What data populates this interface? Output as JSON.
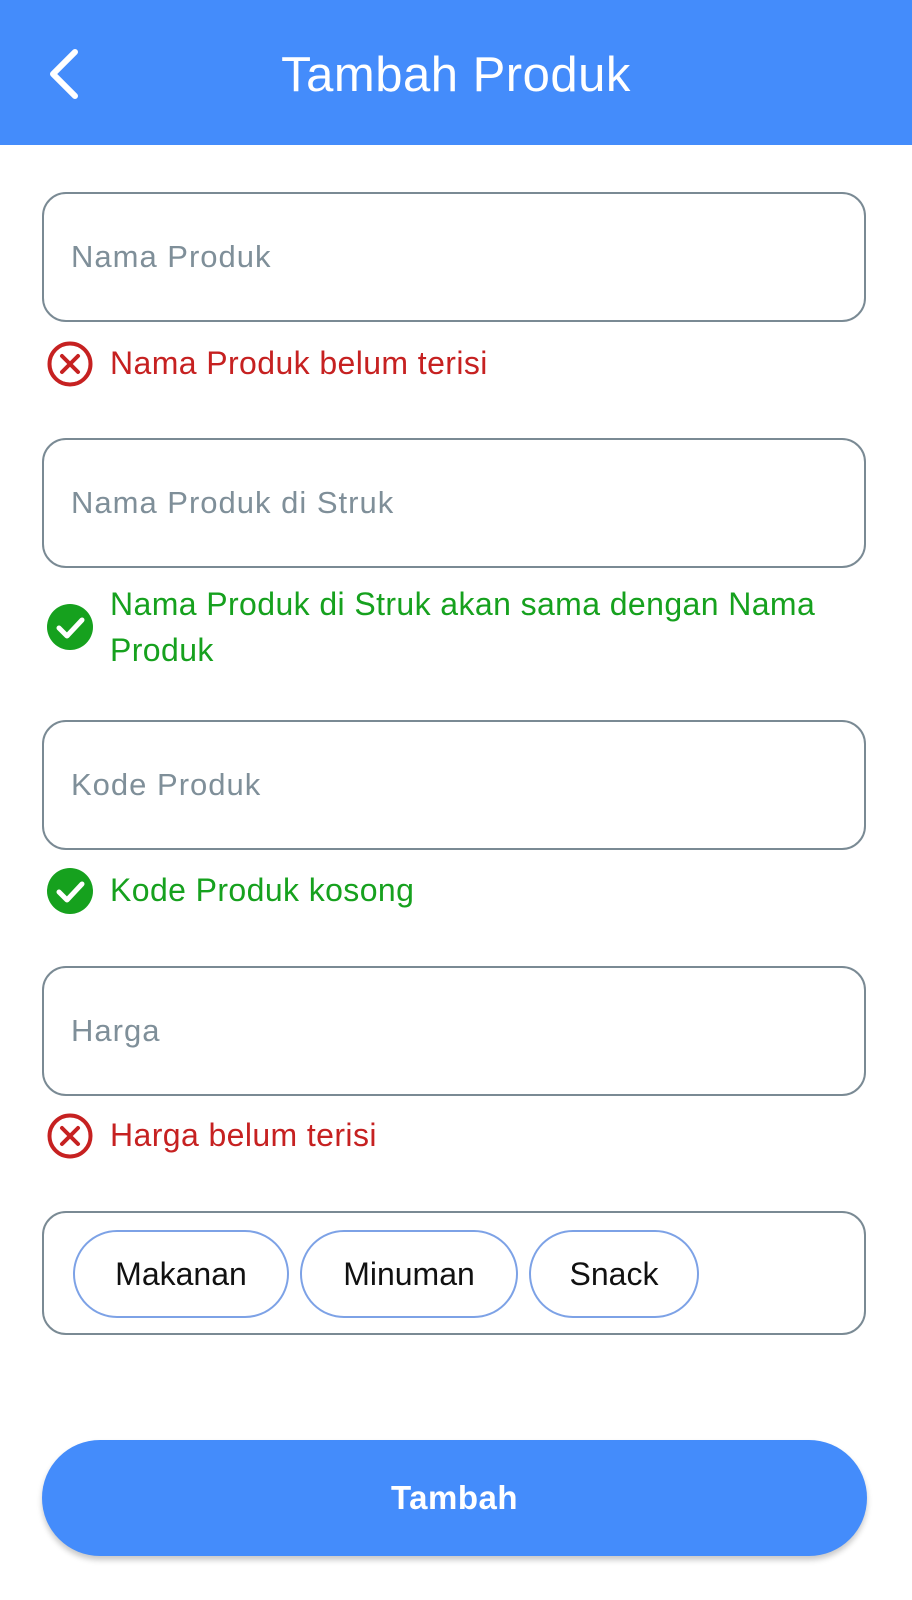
{
  "header": {
    "title": "Tambah Produk",
    "back_icon": "chevron-left-icon",
    "background": "#448cfb"
  },
  "form": {
    "product_name": {
      "value": "",
      "placeholder": "Nama Produk",
      "message": "Nama Produk belum terisi",
      "status": "error"
    },
    "receipt_name": {
      "value": "",
      "placeholder": "Nama Produk di Struk",
      "message": "Nama Produk di Struk akan sama dengan Nama Produk",
      "status": "ok"
    },
    "product_code": {
      "value": "",
      "placeholder": "Kode Produk",
      "message": "Kode Produk kosong",
      "status": "ok"
    },
    "price": {
      "value": "",
      "placeholder": "Harga",
      "message": "Harga belum terisi",
      "status": "error"
    },
    "categories": [
      {
        "label": "Makanan"
      },
      {
        "label": "Minuman"
      },
      {
        "label": "Snack"
      }
    ]
  },
  "submit_label": "Tambah",
  "colors": {
    "primary": "#448cfb",
    "error": "#c62121",
    "success": "#16a11e",
    "field_border": "#7a8a94",
    "chip_border": "#7da2e6"
  }
}
